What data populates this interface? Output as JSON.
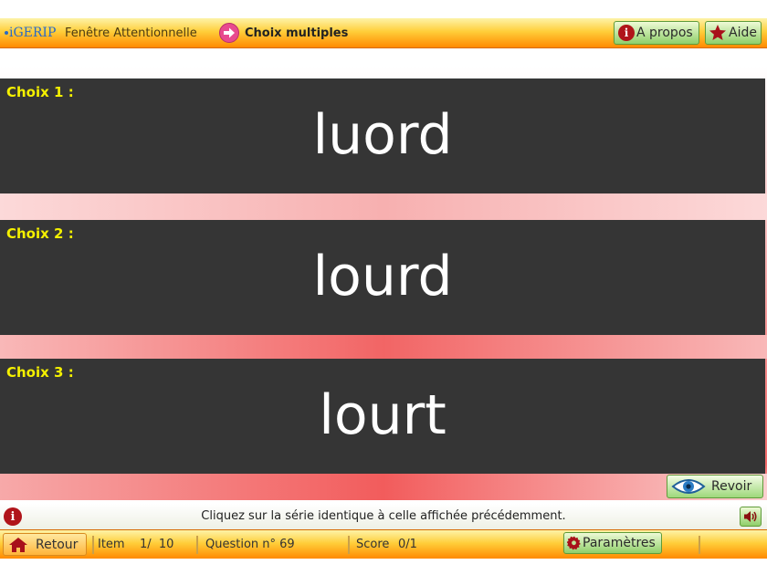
{
  "header": {
    "logo": "iGERIP",
    "app_title": "Fenêtre Attentionnelle",
    "mode_title": "Choix multiples",
    "apropos_label": "A propos",
    "aide_label": "Aide"
  },
  "choices": [
    {
      "label": "Choix 1 :",
      "word": "luord"
    },
    {
      "label": "Choix 2 :",
      "word": "lourd"
    },
    {
      "label": "Choix 3 :",
      "word": "lourt"
    }
  ],
  "revoir_label": "Revoir",
  "instruction": "Cliquez sur la série identique à celle affichée précédemment.",
  "footer": {
    "retour_label": "Retour",
    "item_label": "Item",
    "item_value": "1/  10",
    "question": "Question n° 69",
    "score_label": "Score",
    "score_value": "0/1",
    "params_label": "Paramètres"
  },
  "icons": {
    "apropos": "info-icon",
    "aide": "star-icon",
    "mode": "arrow-right-icon",
    "revoir": "eye-icon",
    "instruction": "info-icon",
    "speaker": "speaker-icon",
    "retour": "home-icon",
    "params": "gear-icon"
  },
  "colors": {
    "choice_bg": "#353535",
    "choice_label": "#f4f000",
    "accent_green": "#8fcf6a",
    "accent_orange": "#ff8a00"
  }
}
